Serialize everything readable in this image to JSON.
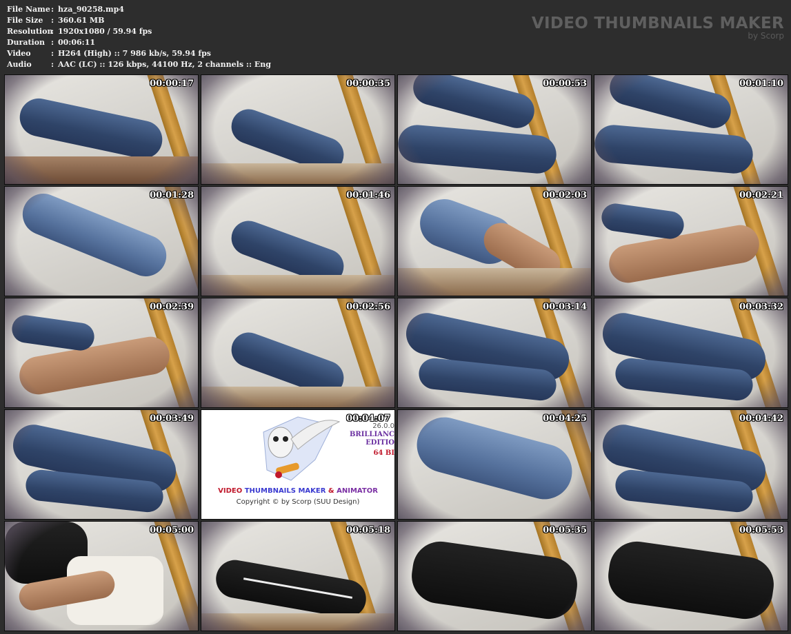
{
  "info": {
    "rows": [
      {
        "key": "File Name",
        "value": "hza_90258.mp4"
      },
      {
        "key": "File Size",
        "value": "360.61 MB"
      },
      {
        "key": "Resolution",
        "value": "1920x1080 / 59.94 fps"
      },
      {
        "key": "Duration",
        "value": "00:06:11"
      },
      {
        "key": "Video",
        "value": "H264 (High) :: 7 986 kb/s, 59.94 fps"
      },
      {
        "key": "Audio",
        "value": "AAC (LC) :: 126 kbps, 44100 Hz, 2 channels :: Eng"
      }
    ],
    "separator": ":"
  },
  "brand": {
    "title": "VIDEO THUMBNAILS MAKER",
    "subtitle": "by Scorp"
  },
  "thumbnails": [
    {
      "time": "00:00:17"
    },
    {
      "time": "00:00:35"
    },
    {
      "time": "00:00:53"
    },
    {
      "time": "00:01:10"
    },
    {
      "time": "00:01:28"
    },
    {
      "time": "00:01:46"
    },
    {
      "time": "00:02:03"
    },
    {
      "time": "00:02:21"
    },
    {
      "time": "00:02:39"
    },
    {
      "time": "00:02:56"
    },
    {
      "time": "00:03:14"
    },
    {
      "time": "00:03:32"
    },
    {
      "time": "00:03:49"
    },
    {
      "time": "00:04:07"
    },
    {
      "time": "00:04:25"
    },
    {
      "time": "00:04:42"
    },
    {
      "time": "00:05:00"
    },
    {
      "time": "00:05:18"
    },
    {
      "time": "00:05:35"
    },
    {
      "time": "00:05:53"
    }
  ],
  "logo_frame": {
    "version": "26.0.0",
    "edition_line1": "BRILLIANC",
    "edition_line2": "EDITIO",
    "bits": "64 BI",
    "app_name_parts": [
      "VIDEO ",
      "THUMBNAILS MAKER",
      " & ",
      "ANIMATOR"
    ],
    "copyright": "Copyright © by Scorp (SUU Design)"
  }
}
